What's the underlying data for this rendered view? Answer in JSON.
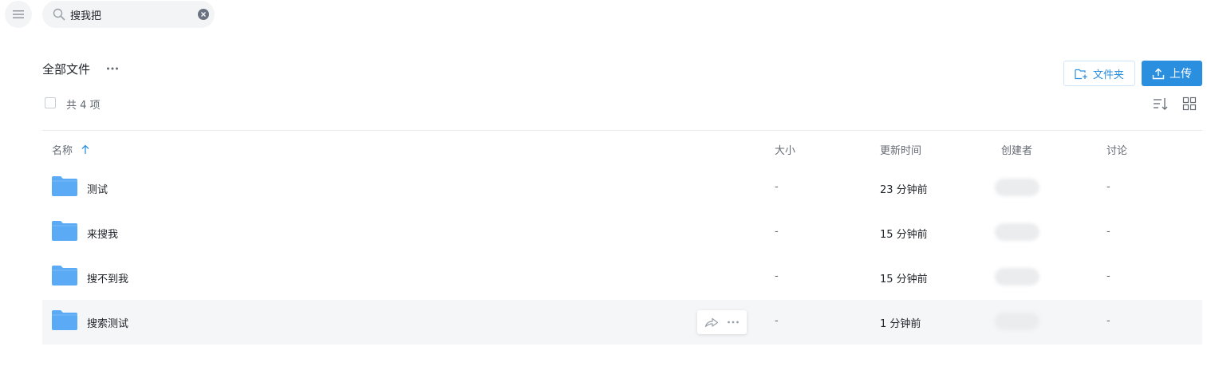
{
  "search": {
    "value": "搜我把"
  },
  "header": {
    "title": "全部文件",
    "new_folder_label": "文件夹",
    "upload_label": "上传"
  },
  "summary": {
    "count_text": "共 4 项"
  },
  "table": {
    "columns": {
      "name": "名称",
      "size": "大小",
      "updated": "更新时间",
      "creator": "创建者",
      "discussion": "讨论"
    },
    "rows": [
      {
        "name": "测试",
        "size": "-",
        "updated": "23 分钟前",
        "discussion": "-"
      },
      {
        "name": "来搜我",
        "size": "-",
        "updated": "15 分钟前",
        "discussion": "-"
      },
      {
        "name": "搜不到我",
        "size": "-",
        "updated": "15 分钟前",
        "discussion": "-"
      },
      {
        "name": "搜索测试",
        "size": "-",
        "updated": "1 分钟前",
        "discussion": "-"
      }
    ]
  },
  "icons": {
    "menu": "menu-icon",
    "search": "search-icon",
    "clear": "clear-icon",
    "more": "more-icon",
    "new_folder": "new-folder-icon",
    "upload": "upload-icon",
    "sort": "sort-icon",
    "grid_view": "grid-view-icon",
    "sort_ascending": "arrow-up-icon",
    "folder": "folder-icon",
    "share": "share-icon"
  },
  "colors": {
    "accent": "#2b8fe0",
    "folder": "#5aaaf5",
    "hover_row": "#f5f6f7"
  }
}
